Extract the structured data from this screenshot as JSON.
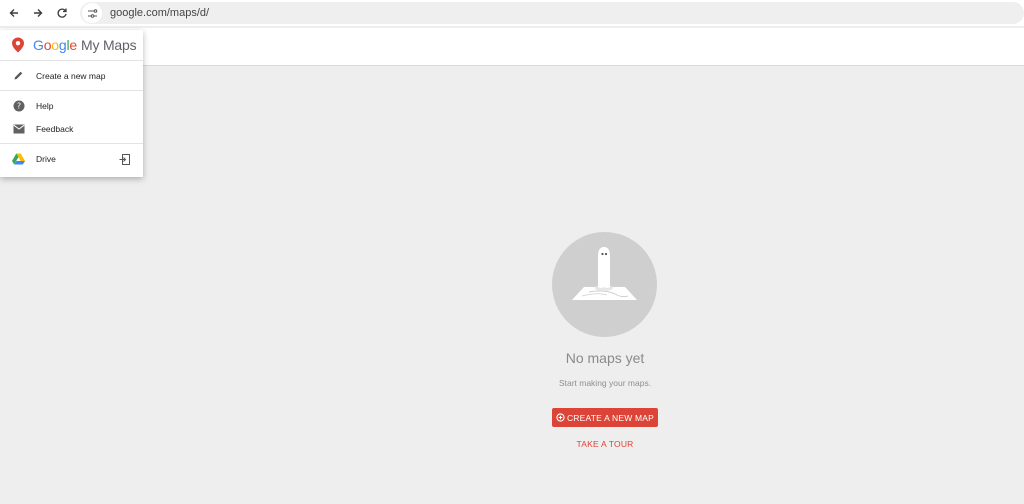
{
  "browser": {
    "url": "google.com/maps/d/",
    "back_icon": "arrow-left-icon",
    "forward_icon": "arrow-right-icon",
    "reload_icon": "reload-icon",
    "site_info_icon": "tune-icon"
  },
  "menu": {
    "brand_google": [
      "G",
      "o",
      "o",
      "g",
      "l",
      "e"
    ],
    "brand_product": "My Maps",
    "brand_colors": [
      "#4285f4",
      "#ea4335",
      "#fbbc05",
      "#4285f4",
      "#34a853",
      "#ea4335"
    ],
    "items": [
      {
        "label": "Create a new map",
        "icon": "pencil-icon"
      },
      {
        "label": "Help",
        "icon": "help-icon"
      },
      {
        "label": "Feedback",
        "icon": "mail-icon"
      },
      {
        "label": "Drive",
        "icon": "drive-icon",
        "trailing_icon": "open-in-icon"
      }
    ]
  },
  "empty_state": {
    "title": "No maps yet",
    "subtitle": "Start making your maps.",
    "cta_label": "CREATE A NEW MAP",
    "tour_label": "TAKE A TOUR",
    "accent_color": "#db4437"
  }
}
